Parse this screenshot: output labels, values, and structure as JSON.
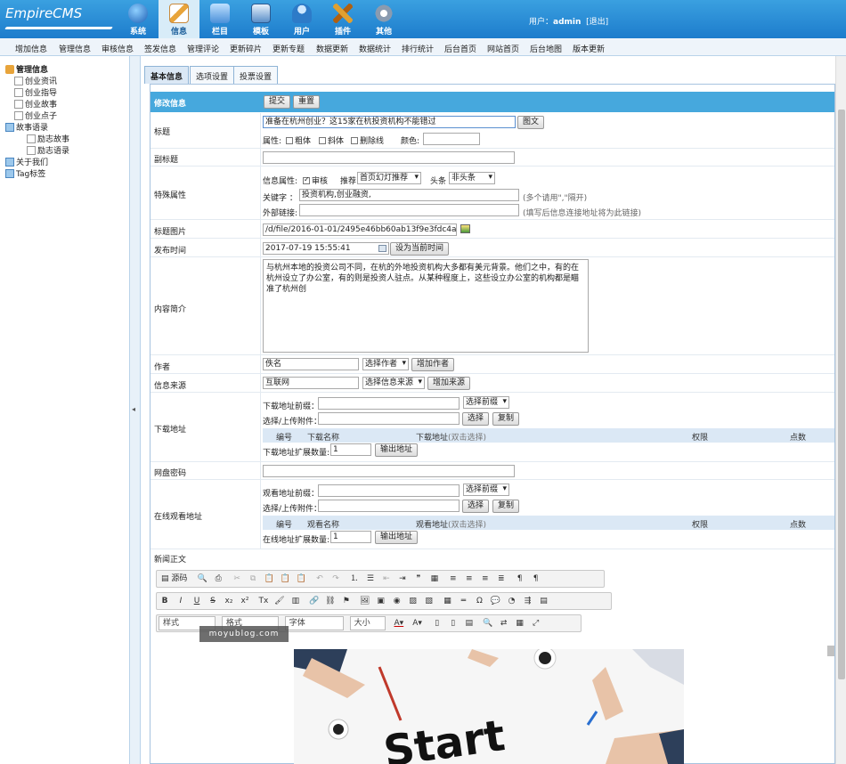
{
  "header": {
    "logo": "EmpireCMS",
    "nav": [
      {
        "label": "系统",
        "icon": "globe-icon",
        "color": "#3b6fc2"
      },
      {
        "label": "信息",
        "icon": "pencil-icon",
        "color": "#e8a43a"
      },
      {
        "label": "栏目",
        "icon": "folder-icon",
        "color": "#4a90d9"
      },
      {
        "label": "模板",
        "icon": "template-icon",
        "color": "#5a8fc8"
      },
      {
        "label": "用户",
        "icon": "user-icon",
        "color": "#5b9ad8"
      },
      {
        "label": "插件",
        "icon": "tools-icon",
        "color": "#e0a030"
      },
      {
        "label": "其他",
        "icon": "gear-icon",
        "color": "#8a9bb0"
      }
    ],
    "user_label": "用户：",
    "user_name": "admin",
    "logout": "[退出]"
  },
  "menu": [
    "增加信息",
    "管理信息",
    "审核信息",
    "签发信息",
    "管理评论",
    "更新碎片",
    "更新专题",
    "数据更新",
    "数据统计",
    "排行统计",
    "后台首页",
    "网站首页",
    "后台地图",
    "版本更新"
  ],
  "sidebar": {
    "root": "管理信息",
    "items": [
      "创业资讯",
      "创业指导",
      "创业故事",
      "创业点子",
      "故事语录",
      "励志故事",
      "励志语录",
      "关于我们",
      "Tag标签"
    ]
  },
  "tabs": [
    "基本信息",
    "选项设置",
    "投票设置"
  ],
  "form": {
    "header": "修改信息",
    "submit": "提交",
    "reset": "重置",
    "title_label": "标题",
    "title_value": "准备在杭州创业？这15家在杭投资机构不能错过",
    "title_img_btn": "图文",
    "attr_label": "属性:",
    "bold": "粗体",
    "italic": "斜体",
    "strike": "删除线",
    "color_label": "颜色:",
    "subtitle_label": "副标题",
    "special_label": "特殊属性",
    "info_attr": "信息属性:",
    "audit": "审核",
    "recommend": "推荐",
    "recommend_value": "首页幻灯推荐",
    "headline": "头条",
    "headline_value": "非头条",
    "keywords_label": "关键字",
    "keywords_value": "投资机构,创业融资,",
    "keywords_hint": "(多个请用\",\"隔开)",
    "extlink_label": "外部链接:",
    "extlink_hint": "(填写后信息连接地址将为此链接)",
    "titlepic_label": "标题图片",
    "titlepic_value": "/d/file/2016-01-01/2495e46bb60ab13f9e3fdc4accc5963",
    "time_label": "发布时间",
    "time_value": "2017-07-19 15:55:41",
    "time_btn": "设为当前时间",
    "summary_label": "内容简介",
    "summary_value": "与杭州本地的投资公司不同，在杭的外地投资机构大多都有美元背景。他们之中，有的在杭州设立了办公室，有的则是投资人驻点。从某种程度上，这些设立办公室的机构都是瞄准了杭州创",
    "author_label": "作者",
    "author_value": "佚名",
    "author_select": "选择作者",
    "author_add": "增加作者",
    "source_label": "信息来源",
    "source_value": "互联网",
    "source_select": "选择信息来源",
    "source_add": "增加来源",
    "download_label": "下载地址",
    "dl_prefix": "下载地址前缀：",
    "prefix_select": "选择前缀",
    "upload_label": "选择/上传附件：",
    "choose": "选择",
    "copy": "复制",
    "dl_cols": [
      "编号",
      "下载名称",
      "下载地址",
      "(双击选择)",
      "权限",
      "点数"
    ],
    "dl_expand": "下载地址扩展数量:",
    "expand_value": "1",
    "dl_output": "输出地址",
    "netdisk_label": "网盘密码",
    "online_label": "在线观看地址",
    "ol_prefix": "观看地址前缀：",
    "ol_cols": [
      "编号",
      "观看名称",
      "观看地址",
      "(双击选择)",
      "权限",
      "点数"
    ],
    "ol_expand": "在线地址扩展数量:",
    "body_label": "新闻正文"
  },
  "editor": {
    "source": "源码",
    "style": "样式",
    "format": "格式",
    "font": "字体",
    "size": "大小"
  },
  "watermark": "moyublog.com"
}
